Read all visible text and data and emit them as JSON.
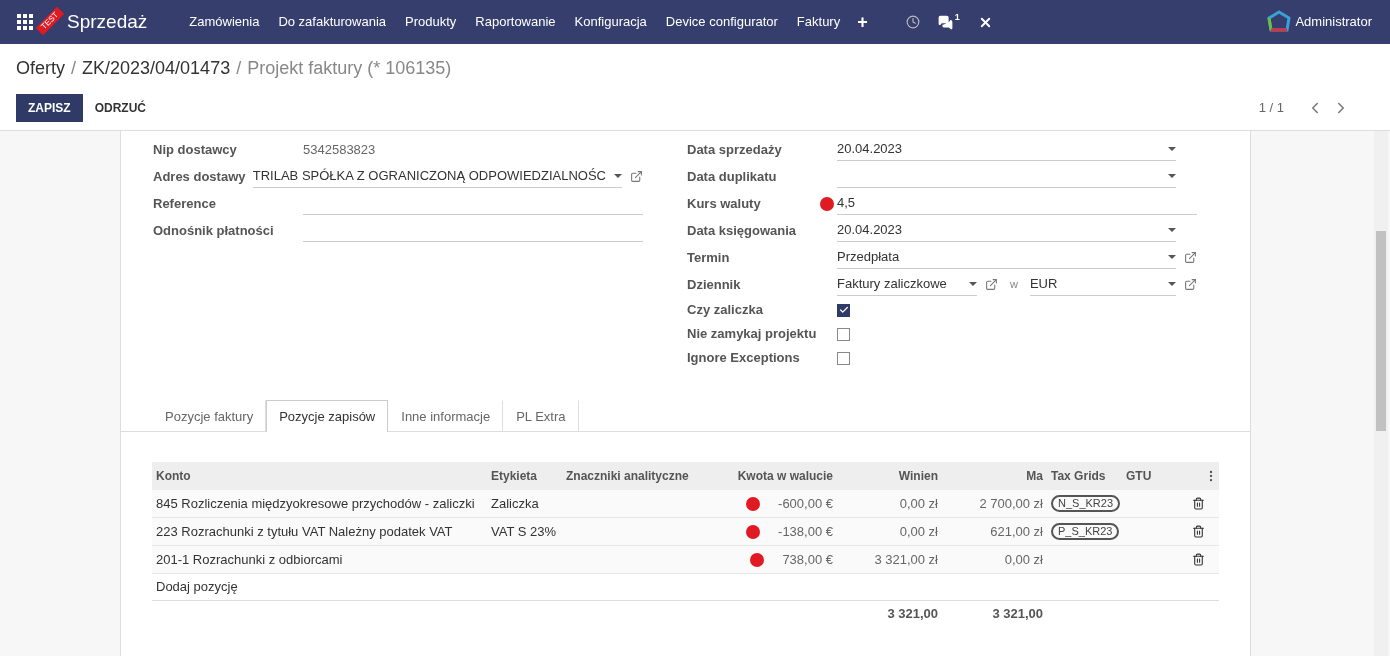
{
  "navbar": {
    "brand": "Sprzedaż",
    "menu": [
      "Zamówienia",
      "Do zafakturowania",
      "Produkty",
      "Raportowanie",
      "Konfiguracja",
      "Device configurator",
      "Faktury"
    ],
    "add": "+",
    "messages_count": "1",
    "user": "Administrator"
  },
  "ribbon": "TEST",
  "breadcrumb_separator": "/",
  "breadcrumb": [
    {
      "label": "Oferty",
      "kind": "link"
    },
    {
      "label": "ZK/2023/04/01473",
      "kind": "link"
    },
    {
      "label": "Projekt faktury (* 106135)",
      "kind": "current"
    }
  ],
  "buttons": [
    {
      "label": "ZAPISZ",
      "kind": "primary"
    },
    {
      "label": "ODRZUĆ",
      "kind": "secondary"
    }
  ],
  "pager": "1 / 1",
  "left_fields": [
    {
      "label": "Nip dostawcy",
      "value": "5342583823",
      "kind": "readonly"
    },
    {
      "label": "Adres dostawy",
      "value": "TRILAB SPÓŁKA Z OGRANICZONĄ ODPOWIEDZIALNOŚC",
      "kind": "select",
      "link": true
    },
    {
      "label": "Reference",
      "kind": "input"
    },
    {
      "label": "Odnośnik płatności",
      "kind": "input"
    }
  ],
  "right_fields": [
    {
      "label": "Data sprzedaży",
      "value": "20.04.2023",
      "kind": "select",
      "link": false
    },
    {
      "label": "Data duplikatu",
      "kind": "select",
      "link": false
    },
    {
      "label": "Kurs waluty",
      "value": "4,5",
      "kind": "input",
      "warning": true
    },
    {
      "label": "Data księgowania",
      "value": "20.04.2023",
      "kind": "select",
      "link": false
    },
    {
      "label": "Termin",
      "value": "Przedpłata",
      "kind": "select",
      "link": true
    },
    {
      "label": "Dziennik",
      "value": "Faktury zaliczkowe",
      "kind": "journal",
      "separator": "w",
      "currency": "EUR"
    },
    {
      "label": "Czy zaliczka",
      "kind": "checkbox",
      "checked": true
    },
    {
      "label": "Nie zamykaj projektu",
      "kind": "checkbox",
      "checked": false
    },
    {
      "label": "Ignore Exceptions",
      "kind": "checkbox",
      "checked": false
    }
  ],
  "tabs": [
    {
      "label": "Pozycje faktury",
      "selected": false
    },
    {
      "label": "Pozycje zapisów",
      "selected": true
    },
    {
      "label": "Inne informacje",
      "selected": false
    },
    {
      "label": "PL Extra",
      "selected": false
    }
  ],
  "table": {
    "columns": [
      "Konto",
      "Etykieta",
      "Znaczniki analityczne",
      "Kwota w walucie",
      "Winien",
      "Ma",
      "Tax Grids",
      "GTU"
    ],
    "rows": [
      {
        "konto": "845 Rozliczenia międzyokresowe przychodów - zaliczki",
        "etykieta": "Zaliczka",
        "kwota": "-600,00 €",
        "winien": "0,00 zł",
        "ma": "2 700,00 zł",
        "tax_grid": "N_S_KR23",
        "warning": true
      },
      {
        "konto": "223 Rozrachunki z tytułu VAT Należny podatek VAT",
        "etykieta": "VAT S 23%",
        "kwota": "-138,00 €",
        "winien": "0,00 zł",
        "ma": "621,00 zł",
        "tax_grid": "P_S_KR23",
        "warning": true
      },
      {
        "konto": "201-1 Rozrachunki z odbiorcami",
        "kwota": "738,00 €",
        "winien": "3 321,00 zł",
        "ma": "0,00 zł",
        "warning": true
      }
    ],
    "add_line": "Dodaj pozycję",
    "totals": {
      "winien": "3 321,00",
      "ma": "3 321,00"
    }
  }
}
